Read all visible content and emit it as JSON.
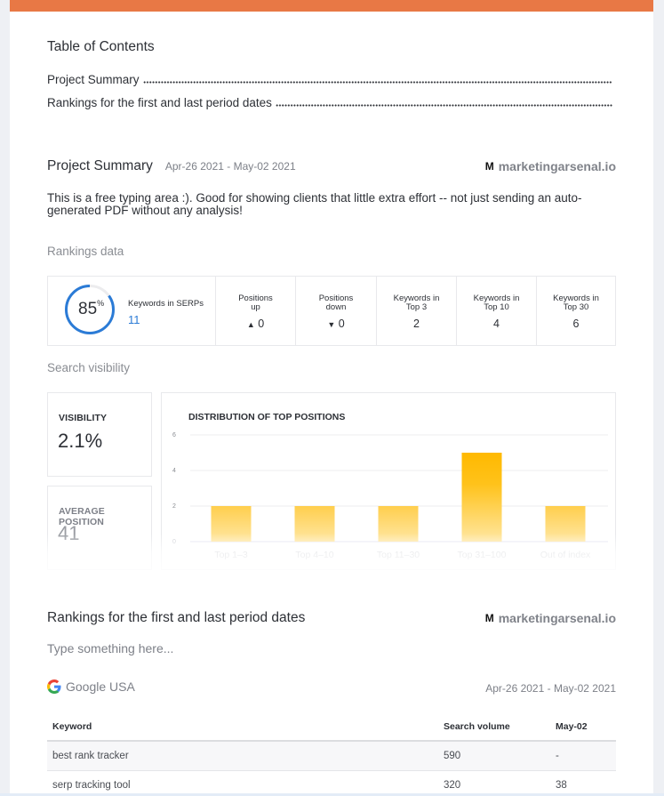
{
  "toc": {
    "title": "Table of Contents",
    "items": [
      {
        "label": "Project Summary"
      },
      {
        "label": "Rankings for the first and last period dates"
      }
    ]
  },
  "summary": {
    "title": "Project Summary",
    "date_range": "Apr-26 2021 - May-02 2021",
    "brand": "marketingarsenal.io",
    "brand_logo": "M",
    "free_text": "This is a free typing area :). Good for showing clients that little extra effort -- not just sending an auto-generated PDF without any analysis!",
    "rankings_label": "Rankings data",
    "rankings": {
      "serp_percent": 85,
      "serp_percent_label": "85",
      "percent_sign": "%",
      "keywords_in_serps_label": "Keywords in SERPs",
      "keywords_in_serps_value": "11",
      "cells": [
        {
          "label": "Positions up",
          "value": "0",
          "trend": "up",
          "arrow": "▲"
        },
        {
          "label": "Positions down",
          "value": "0",
          "trend": "down",
          "arrow": "▼"
        },
        {
          "label": "Keywords in Top 3",
          "value": "2"
        },
        {
          "label": "Keywords in Top 10",
          "value": "4"
        },
        {
          "label": "Keywords in Top 30",
          "value": "6"
        }
      ]
    },
    "visibility_label": "Search visibility",
    "visibility": {
      "label": "VISIBILITY",
      "value": "2.1%"
    },
    "avg_position": {
      "label": "AVERAGE POSITION",
      "value": "41"
    }
  },
  "colors": {
    "accent_band": "#e87845",
    "gauge": "#2b7bd6",
    "bar_top": "#ffb900",
    "bar_bottom": "#ffe7a3",
    "up": "#1e8a1e",
    "down": "#ee4b4b"
  },
  "chart_data": {
    "type": "bar",
    "title": "DISTRIBUTION OF TOP POSITIONS",
    "categories": [
      "Top 1–3",
      "Top 4–10",
      "Top 11–30",
      "Top 31–100",
      "Out of index"
    ],
    "values": [
      2,
      2,
      2,
      5,
      2
    ],
    "yticks": [
      0,
      2,
      4,
      6
    ],
    "ylim": [
      0,
      6
    ],
    "xlabel": "",
    "ylabel": "",
    "grid": true,
    "legend": "none"
  },
  "rankings_section": {
    "title": "Rankings for the first and last period dates",
    "brand": "marketingarsenal.io",
    "brand_logo": "M",
    "placeholder": "Type something here...",
    "engine": "Google USA",
    "date_range": "Apr-26 2021 - May-02 2021",
    "table": {
      "headers": [
        "Keyword",
        "Search volume",
        "May-02"
      ],
      "rows": [
        [
          "best rank tracker",
          "590",
          "-"
        ],
        [
          "serp tracking tool",
          "320",
          "38"
        ]
      ]
    }
  }
}
